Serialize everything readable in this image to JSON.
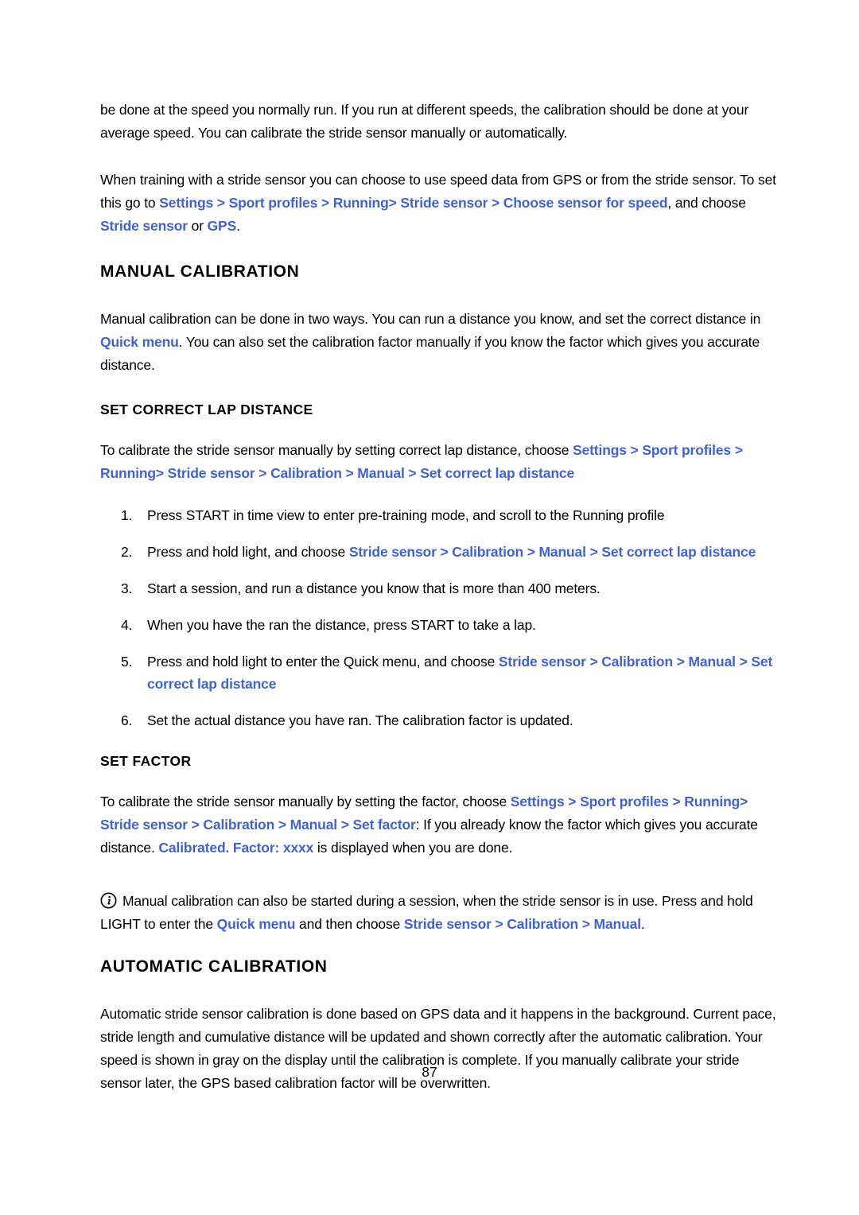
{
  "document": {
    "page_number": "87",
    "accent_color": "#3f62d8",
    "text_color": "#000000",
    "background_color": "#ffffff"
  },
  "intro": {
    "para1": "be done at the speed you normally run. If you run at different speeds, the calibration should be done at your average speed. You can calibrate the stride sensor manually or automatically.",
    "para2_a": "When training with a stride sensor you can choose to use speed data from GPS or from the stride sensor. To set this go to ",
    "para2_nav1": "Settings > Sport profiles > Running> Stride sensor > Choose sensor for speed",
    "para2_b": ", and choose ",
    "para2_nav2": "Stride sensor",
    "para2_c": " or ",
    "para2_nav3": "GPS",
    "para2_d": "."
  },
  "manual": {
    "heading": "MANUAL CALIBRATION",
    "intro_a": "Manual calibration can be done in two ways. You can run a distance you know, and set the correct distance in ",
    "intro_nav": "Quick menu",
    "intro_b": ". You can also set the calibration factor manually if you know the factor which gives you accurate distance."
  },
  "set_correct_lap_distance": {
    "heading": "SET CORRECT LAP DISTANCE",
    "intro_a": "To calibrate the stride sensor manually by setting correct lap distance, choose ",
    "intro_nav": "Settings > Sport profiles > Running> Stride sensor > Calibration > Manual > Set correct lap distance",
    "steps": [
      {
        "num": "1.",
        "text_a": "Press START in time view to enter pre-training mode, and scroll to the Running profile",
        "nav": "",
        "text_b": ""
      },
      {
        "num": "2.",
        "text_a": "Press and hold light, and choose ",
        "nav": "Stride sensor > Calibration > Manual > Set correct lap distance",
        "text_b": ""
      },
      {
        "num": "3.",
        "text_a": "Start a session, and run a distance you know that is more than 400 meters.",
        "nav": "",
        "text_b": ""
      },
      {
        "num": "4.",
        "text_a": "When you have the ran the distance, press START to take a lap.",
        "nav": "",
        "text_b": ""
      },
      {
        "num": "5.",
        "text_a": "Press and hold light to enter the Quick menu, and choose ",
        "nav": "Stride sensor > Calibration > Manual > Set correct lap distance",
        "text_b": ""
      },
      {
        "num": "6.",
        "text_a": "Set the actual distance you have ran. The calibration factor is updated.",
        "nav": "",
        "text_b": ""
      }
    ]
  },
  "set_factor": {
    "heading": "SET FACTOR",
    "intro_a": "To calibrate the stride sensor manually by setting the factor, choose ",
    "intro_nav1": "Settings > Sport profiles > Running> Stride sensor > Calibration > Manual > Set factor",
    "intro_b": ": If you already know the factor which gives you accurate distance. ",
    "intro_nav2": "Calibrated. Factor: xxxx",
    "intro_c": " is displayed when you are done."
  },
  "note": {
    "icon": "info-circle-icon",
    "text_a": "Manual calibration can also be started during a session, when the stride sensor is in use. Press and hold LIGHT to enter the ",
    "nav1": "Quick menu",
    "text_b": " and then choose ",
    "nav2": "Stride sensor > Calibration > Manual",
    "text_c": "."
  },
  "automatic": {
    "heading": "AUTOMATIC CALIBRATION",
    "para": "Automatic stride sensor calibration is done based on GPS data and it happens in the background. Current pace, stride length and cumulative distance will be updated and shown correctly after the automatic calibration. Your speed is shown in gray on the display until the calibration is complete. If you manually calibrate your stride sensor later, the GPS based calibration factor will be overwritten."
  }
}
